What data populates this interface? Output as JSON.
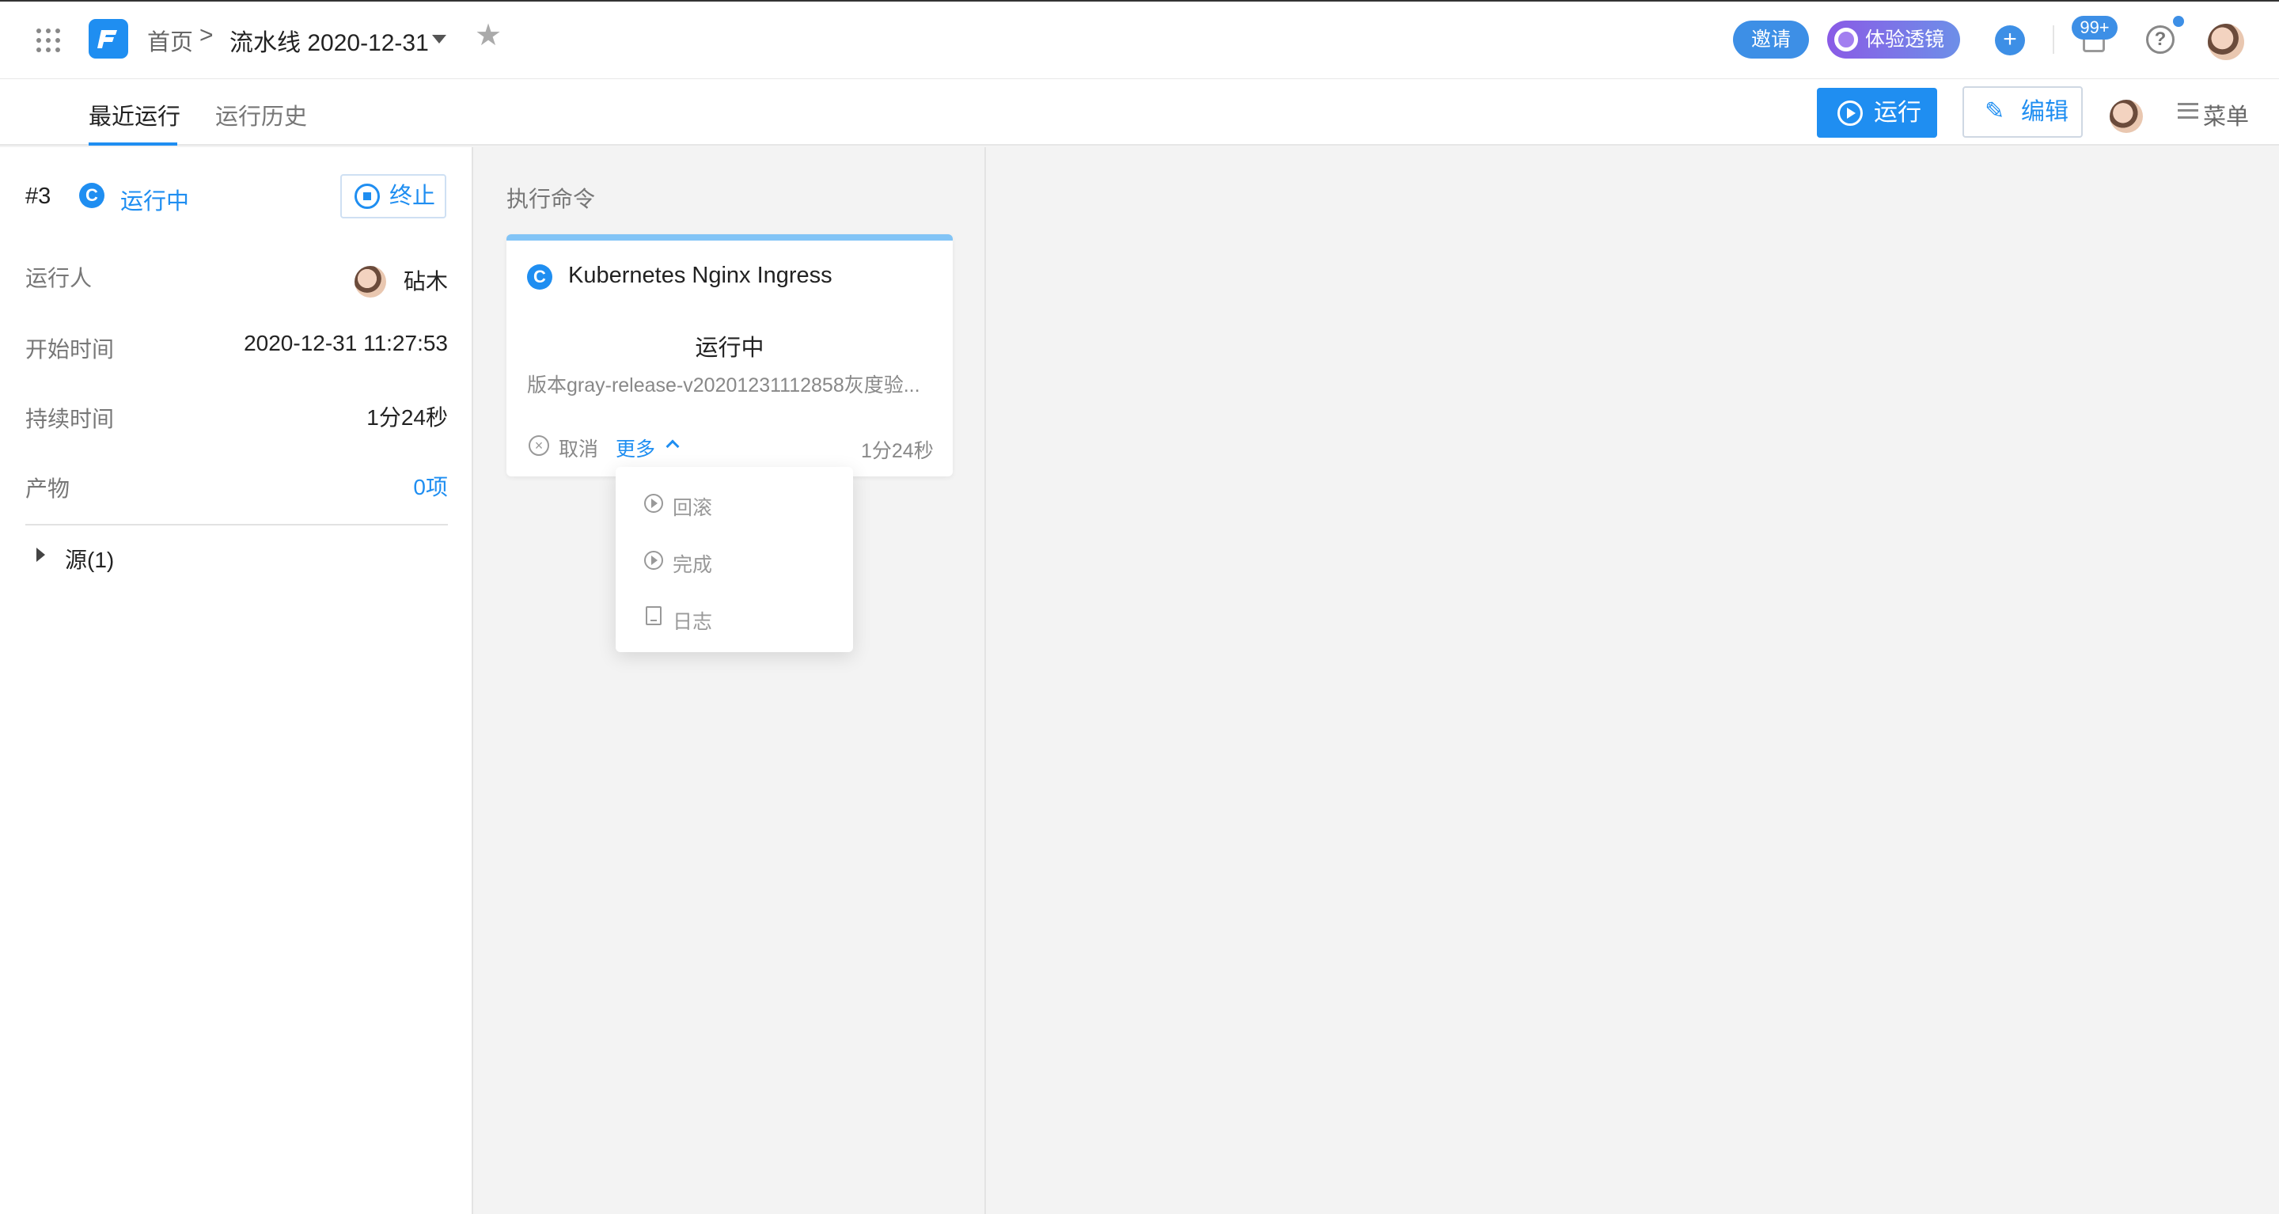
{
  "header": {
    "home": "首页",
    "separator": ">",
    "pipeline_title": "流水线 2020-12-31",
    "invite": "邀请",
    "lens": "体验透镜",
    "plus": "+",
    "notification_count": "99+",
    "help": "?"
  },
  "tabs": {
    "recent": "最近运行",
    "history": "运行历史"
  },
  "actions": {
    "run": "运行",
    "edit": "编辑",
    "menu": "菜单"
  },
  "run_info": {
    "number": "#3",
    "status": "运行中",
    "stop": "终止",
    "runner_label": "运行人",
    "runner": "砧木",
    "start_label": "开始时间",
    "start": "2020-12-31 11:27:53",
    "duration_label": "持续时间",
    "duration": "1分24秒",
    "artifacts_label": "产物",
    "artifacts": "0项",
    "source": "源(1)"
  },
  "stage": {
    "title": "执行命令",
    "card": {
      "name": "Kubernetes Nginx Ingress",
      "status": "运行中",
      "description": "版本gray-release-v20201231112858灰度验...",
      "cancel": "取消",
      "more": "更多",
      "elapsed": "1分24秒"
    }
  },
  "dropdown": {
    "items": [
      {
        "label": "回滚",
        "icon": "play-circle-icon"
      },
      {
        "label": "完成",
        "icon": "play-circle-icon"
      },
      {
        "label": "日志",
        "icon": "book-icon"
      }
    ]
  },
  "colors": {
    "accent": "#1f8ef1",
    "lens_gradient_start": "#8a5be6",
    "lens_gradient_end": "#6d8fe8",
    "card_top_bar": "#82c4f6"
  }
}
